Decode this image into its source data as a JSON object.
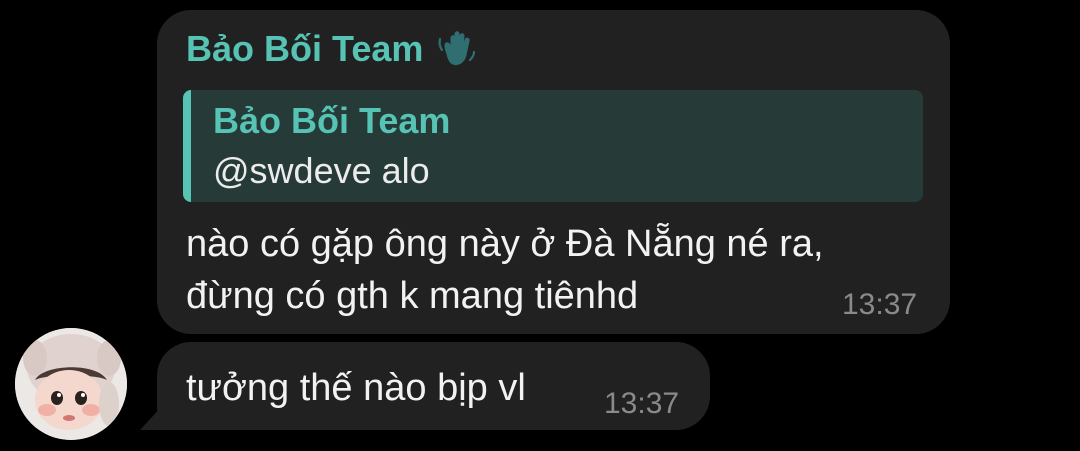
{
  "chat": {
    "message1": {
      "sender": "Bảo Bối Team",
      "sender_icon": "waving-hand-icon",
      "reply": {
        "author": "Bảo Bối Team",
        "text": "@swdeve alo"
      },
      "line1": "nào có gặp ông này ở Đà Nẵng né ra,",
      "line2": "đừng có gth k mang tiênhd",
      "time": "13:37"
    },
    "message2": {
      "text": "tưởng thế nào bịp vl",
      "time": "13:37"
    }
  },
  "colors": {
    "background": "#000000",
    "bubble": "#212121",
    "accent": "#56c3b4",
    "quote_background": "#263a38",
    "text": "#f2f2f2",
    "time": "#8a8a8a"
  }
}
